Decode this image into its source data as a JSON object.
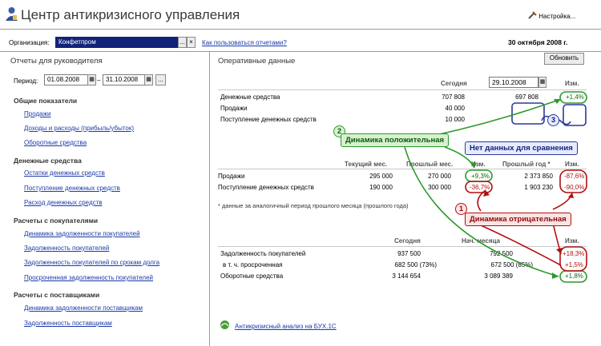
{
  "header": {
    "title": "Центр антикризисного управления",
    "settings_label": "Настройка...",
    "org_label": "Организация:",
    "org_value": "Конфетпром",
    "org_select_label": "...",
    "org_clear_label": "×",
    "help_link": "Как пользоваться отчетами?",
    "date": "30 октября 2008 г."
  },
  "sidebar": {
    "title": "Отчеты для руководителя",
    "period_label": "Период:",
    "period_from": "01.08.2008",
    "period_to": "31.10.2008",
    "period_sep": "–",
    "period_select_label": "...",
    "sections": [
      {
        "title": "Общие показатели",
        "items": [
          "Продажи",
          "Доходы и расходы (прибыль/убыток)",
          "Оборотные средства"
        ]
      },
      {
        "title": "Денежные средства",
        "items": [
          "Остатки денежных средств",
          "Поступление денежных средств",
          "Расход денежных средств"
        ]
      },
      {
        "title": "Расчеты с покупателями",
        "items": [
          "Динамика задолженности покупателей",
          "Задолженность покупателей",
          "Задолженность покупателей по срокам долга",
          "Просроченная задолженность покупателей"
        ]
      },
      {
        "title": "Расчеты с поставщиками",
        "items": [
          "Динамика задолженности поставщикам",
          "Задолженность поставщикам"
        ]
      }
    ]
  },
  "main": {
    "title": "Оперативные данные",
    "refresh_label": "Обновить",
    "block1": {
      "col_today": "Сегодня",
      "date_value": "29.10.2008",
      "col_change": "Изм.",
      "rows": [
        {
          "label": "Денежные средства",
          "today": "707 808",
          "prev": "697 808",
          "change": "+1,4%",
          "sign": "pos"
        },
        {
          "label": "Продажи",
          "today": "40 000",
          "prev": "",
          "change": "",
          "sign": ""
        },
        {
          "label": "Поступление денежных средств",
          "today": "10 000",
          "prev": "",
          "change": "",
          "sign": ""
        }
      ]
    },
    "block2": {
      "col_cur": "Текущий мес.",
      "col_prev": "Прошлый мес.",
      "col_change1": "Изм.",
      "col_year": "Прошлый год *",
      "col_change2": "Изм.",
      "rows": [
        {
          "label": "Продажи",
          "cur": "295 000",
          "prev": "270 000",
          "change1": "+9,3%",
          "sign1": "pos",
          "year": "2 373 850",
          "change2": "-87,6%",
          "sign2": "neg"
        },
        {
          "label": "Поступление денежных средств",
          "cur": "190 000",
          "prev": "300 000",
          "change1": "-36,7%",
          "sign1": "neg",
          "year": "1 903 230",
          "change2": "-90,0%",
          "sign2": "neg"
        }
      ],
      "footnote": "* данные за аналогичный период прошлого месяца (прошлого года)"
    },
    "block3": {
      "col_today": "Сегодня",
      "col_start": "Нач. месяца",
      "col_change": "Изм.",
      "rows": [
        {
          "label": "Задолженность покупателей",
          "today": "937 500",
          "start": "792 500",
          "change": "+18,3%",
          "sign": "neg"
        },
        {
          "label": "в т. ч. просроченная",
          "today": "682 500 (73%)",
          "start": "672 500 (85%)",
          "change": "+1,5%",
          "sign": "neg"
        },
        {
          "label": "Оборотные средства",
          "today": "3 144 654",
          "start": "3 089 389",
          "change": "+1,8%",
          "sign": "pos"
        }
      ]
    },
    "footer_link": "Антикризисный анализ на БУХ.1С"
  },
  "callouts": {
    "positive": {
      "num": "2",
      "text": "Динамика положительная"
    },
    "nodata": {
      "num": "3",
      "text": "Нет данных для сравнения"
    },
    "negative": {
      "num": "1",
      "text": "Динамика отрицательная"
    }
  },
  "colors": {
    "positive": "#0a6a0a",
    "negative": "#b01010",
    "green_callout": "#d8f0d0",
    "blue_callout": "#e6ebff",
    "red_callout": "#fde3e3",
    "link": "#1b3aa8"
  },
  "icons": [
    "user-icon",
    "settings-icon",
    "calendar-icon",
    "buh-logo-icon"
  ]
}
